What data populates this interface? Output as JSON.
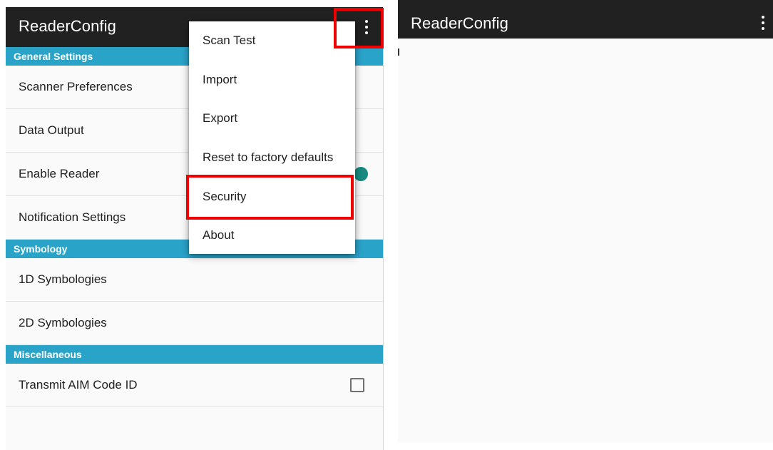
{
  "left_screen": {
    "app_title": "ReaderConfig",
    "sections": [
      {
        "header": "General Settings",
        "items": [
          "Scanner Preferences",
          "Data Output",
          "Enable Reader",
          "Notification Settings"
        ]
      },
      {
        "header": "Symbology",
        "items": [
          "1D Symbologies",
          "2D Symbologies"
        ]
      },
      {
        "header": "Miscellaneous",
        "items": [
          "Transmit AIM Code ID"
        ]
      }
    ],
    "overflow_menu": {
      "items": [
        "Scan Test",
        "Import",
        "Export",
        "Reset to factory defaults",
        "Security",
        "About"
      ],
      "highlighted_item": "Security"
    },
    "enable_reader_toggle": {
      "state": "on",
      "color": "#168a80"
    },
    "transmit_aim_checkbox": {
      "checked": false
    }
  },
  "right_screen": {
    "app_title": "ReaderConfig"
  },
  "colors": {
    "app_bar": "#212121",
    "section_header": "#2aa3c9",
    "highlight_box": "#ee0000"
  },
  "icons": {
    "overflow": "more-vert-icon"
  }
}
